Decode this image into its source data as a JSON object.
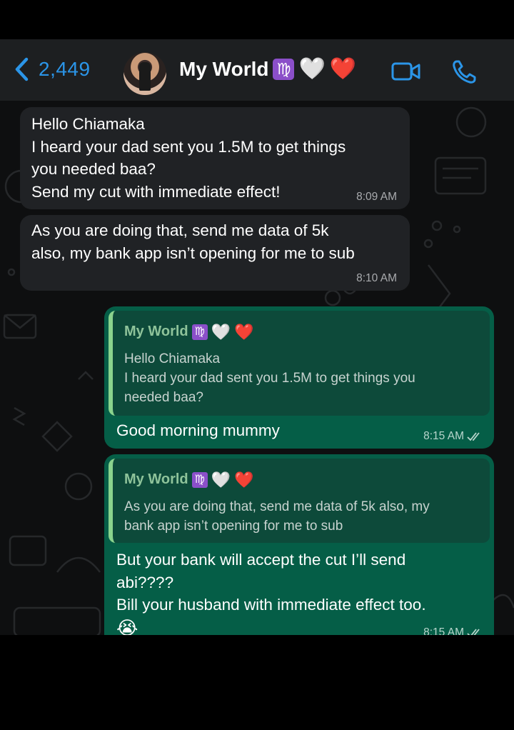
{
  "header": {
    "back_count": "2,449",
    "chat_name": "My World",
    "name_emojis": {
      "zodiac": "♍",
      "white_heart": "🤍",
      "red_heart": "❤️"
    },
    "icons": {
      "back": "chevron-left-icon",
      "video": "video-camera-icon",
      "call": "phone-icon"
    },
    "accent_color": "#2b95e8"
  },
  "messages": [
    {
      "direction": "incoming",
      "text": "Hello Chiamaka\nI heard your dad sent you 1.5M to get things\nyou needed baa?\nSend my cut with immediate effect!",
      "time": "8:09 AM"
    },
    {
      "direction": "incoming",
      "text": "As you are doing that, send me data of 5k\nalso, my bank app isn’t opening for me to sub",
      "time": "8:10 AM"
    },
    {
      "direction": "outgoing",
      "quote_author": "My World",
      "quote_text": "Hello Chiamaka\nI heard your dad sent you 1.5M to get things you\nneeded baa?",
      "text": "Good morning mummy",
      "time": "8:15 AM"
    },
    {
      "direction": "outgoing",
      "quote_author": "My World",
      "quote_text": "As you are doing that, send me data of 5k also, my\nbank app isn’t opening for me to sub",
      "text": "But your bank will accept the cut I’ll send\nabi????\nBill your husband with immediate effect too.",
      "emoji": "😭",
      "time": "8:15 AM"
    }
  ],
  "colors": {
    "incoming_bubble": "#202225",
    "outgoing_bubble": "#055e47",
    "quote_bar": "#8ad38d"
  }
}
